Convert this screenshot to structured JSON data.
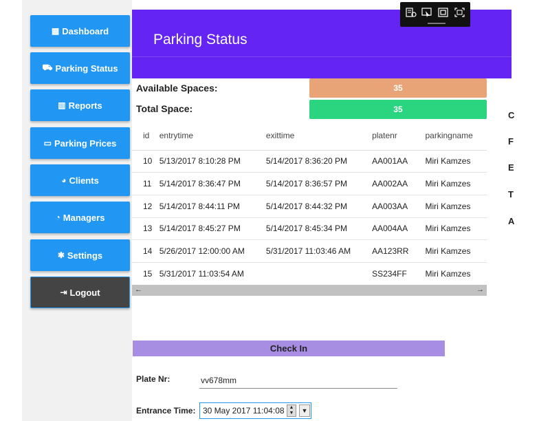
{
  "sidebar": {
    "items": [
      {
        "label": "Dashboard",
        "icon": "dashboard-icon"
      },
      {
        "label": "Parking Status",
        "icon": "car-icon"
      },
      {
        "label": "Reports",
        "icon": "bar-chart-icon"
      },
      {
        "label": "Parking Prices",
        "icon": "money-icon"
      },
      {
        "label": "Clients",
        "icon": "pie-icon"
      },
      {
        "label": "Managers",
        "icon": "pie-icon"
      },
      {
        "label": "Settings",
        "icon": "gear-icon"
      },
      {
        "label": "Logout",
        "icon": "sign-out-icon"
      }
    ]
  },
  "header": {
    "title": "Parking Status"
  },
  "stats": {
    "available_label": "Available Spaces:",
    "available_value": "35",
    "total_label": "Total Space:",
    "total_value": "35"
  },
  "table": {
    "columns": [
      "id",
      "entrytime",
      "exittime",
      "platenr",
      "parkingname"
    ],
    "rows": [
      [
        "10",
        "5/13/2017 8:10:28 PM",
        "5/14/2017 8:36:20 PM",
        "AA001AA",
        "Miri Kamzes"
      ],
      [
        "11",
        "5/14/2017 8:36:47 PM",
        "5/14/2017 8:36:57 PM",
        "AA002AA",
        "Miri Kamzes"
      ],
      [
        "12",
        "5/14/2017 8:44:11 PM",
        "5/14/2017 8:44:32 PM",
        "AA003AA",
        "Miri Kamzes"
      ],
      [
        "13",
        "5/14/2017 8:45:27 PM",
        "5/14/2017 8:45:34 PM",
        "AA004AA",
        "Miri Kamzes"
      ],
      [
        "14",
        "5/26/2017 12:00:00 AM",
        "5/31/2017 11:03:46 AM",
        "AA123RR",
        "Miri Kamzes"
      ],
      [
        "15",
        "5/31/2017 11:03:54 AM",
        "",
        "SS234FF",
        "Miri Kamzes"
      ]
    ]
  },
  "right_panel_letters": [
    "C",
    "F",
    "E",
    "T",
    "A"
  ],
  "checkin": {
    "title": "Check In",
    "plate_label": "Plate Nr:",
    "plate_value": "vv678mm",
    "time_label": "Entrance Time:",
    "time_value": "30 May 2017 11:04:08"
  },
  "colors": {
    "nav_button": "#2196f3",
    "header": "#6425f4",
    "available": "#e8a477",
    "total": "#2bd47e",
    "checkin": "#a78ee2",
    "logout": "#444444"
  }
}
